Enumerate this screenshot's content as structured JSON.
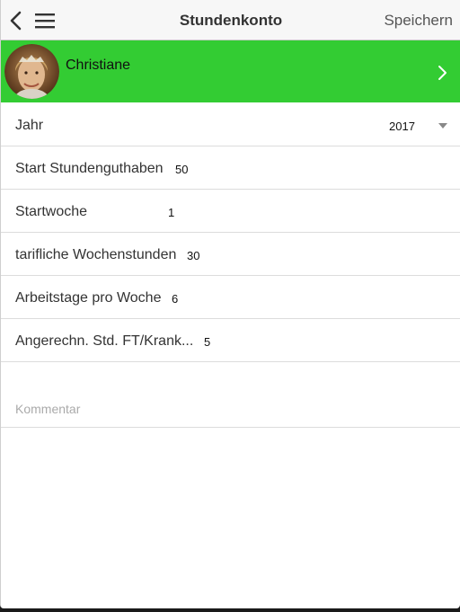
{
  "header": {
    "title": "Stundenkonto",
    "save_label": "Speichern",
    "back_icon": "chevron-left-icon",
    "menu_icon": "hamburger-menu-icon",
    "background": "#f7f7f7"
  },
  "user": {
    "name": "Christiane",
    "banner_color": "#33cc33",
    "chevron_icon": "chevron-right-icon"
  },
  "fields": {
    "year": {
      "label": "Jahr",
      "value": "2017"
    },
    "start_balance": {
      "label": "Start Stundenguthaben",
      "value": "50"
    },
    "start_week": {
      "label": "Startwoche",
      "value": "1"
    },
    "weekly_hours": {
      "label": "tarifliche Wochenstunden",
      "value": "30"
    },
    "workdays": {
      "label": "Arbeitstage pro Woche",
      "value": "6"
    },
    "credited_hours": {
      "label": "Angerechn. Std. FT/Krank...",
      "value": "5"
    }
  },
  "comment": {
    "placeholder": "Kommentar",
    "value": ""
  }
}
